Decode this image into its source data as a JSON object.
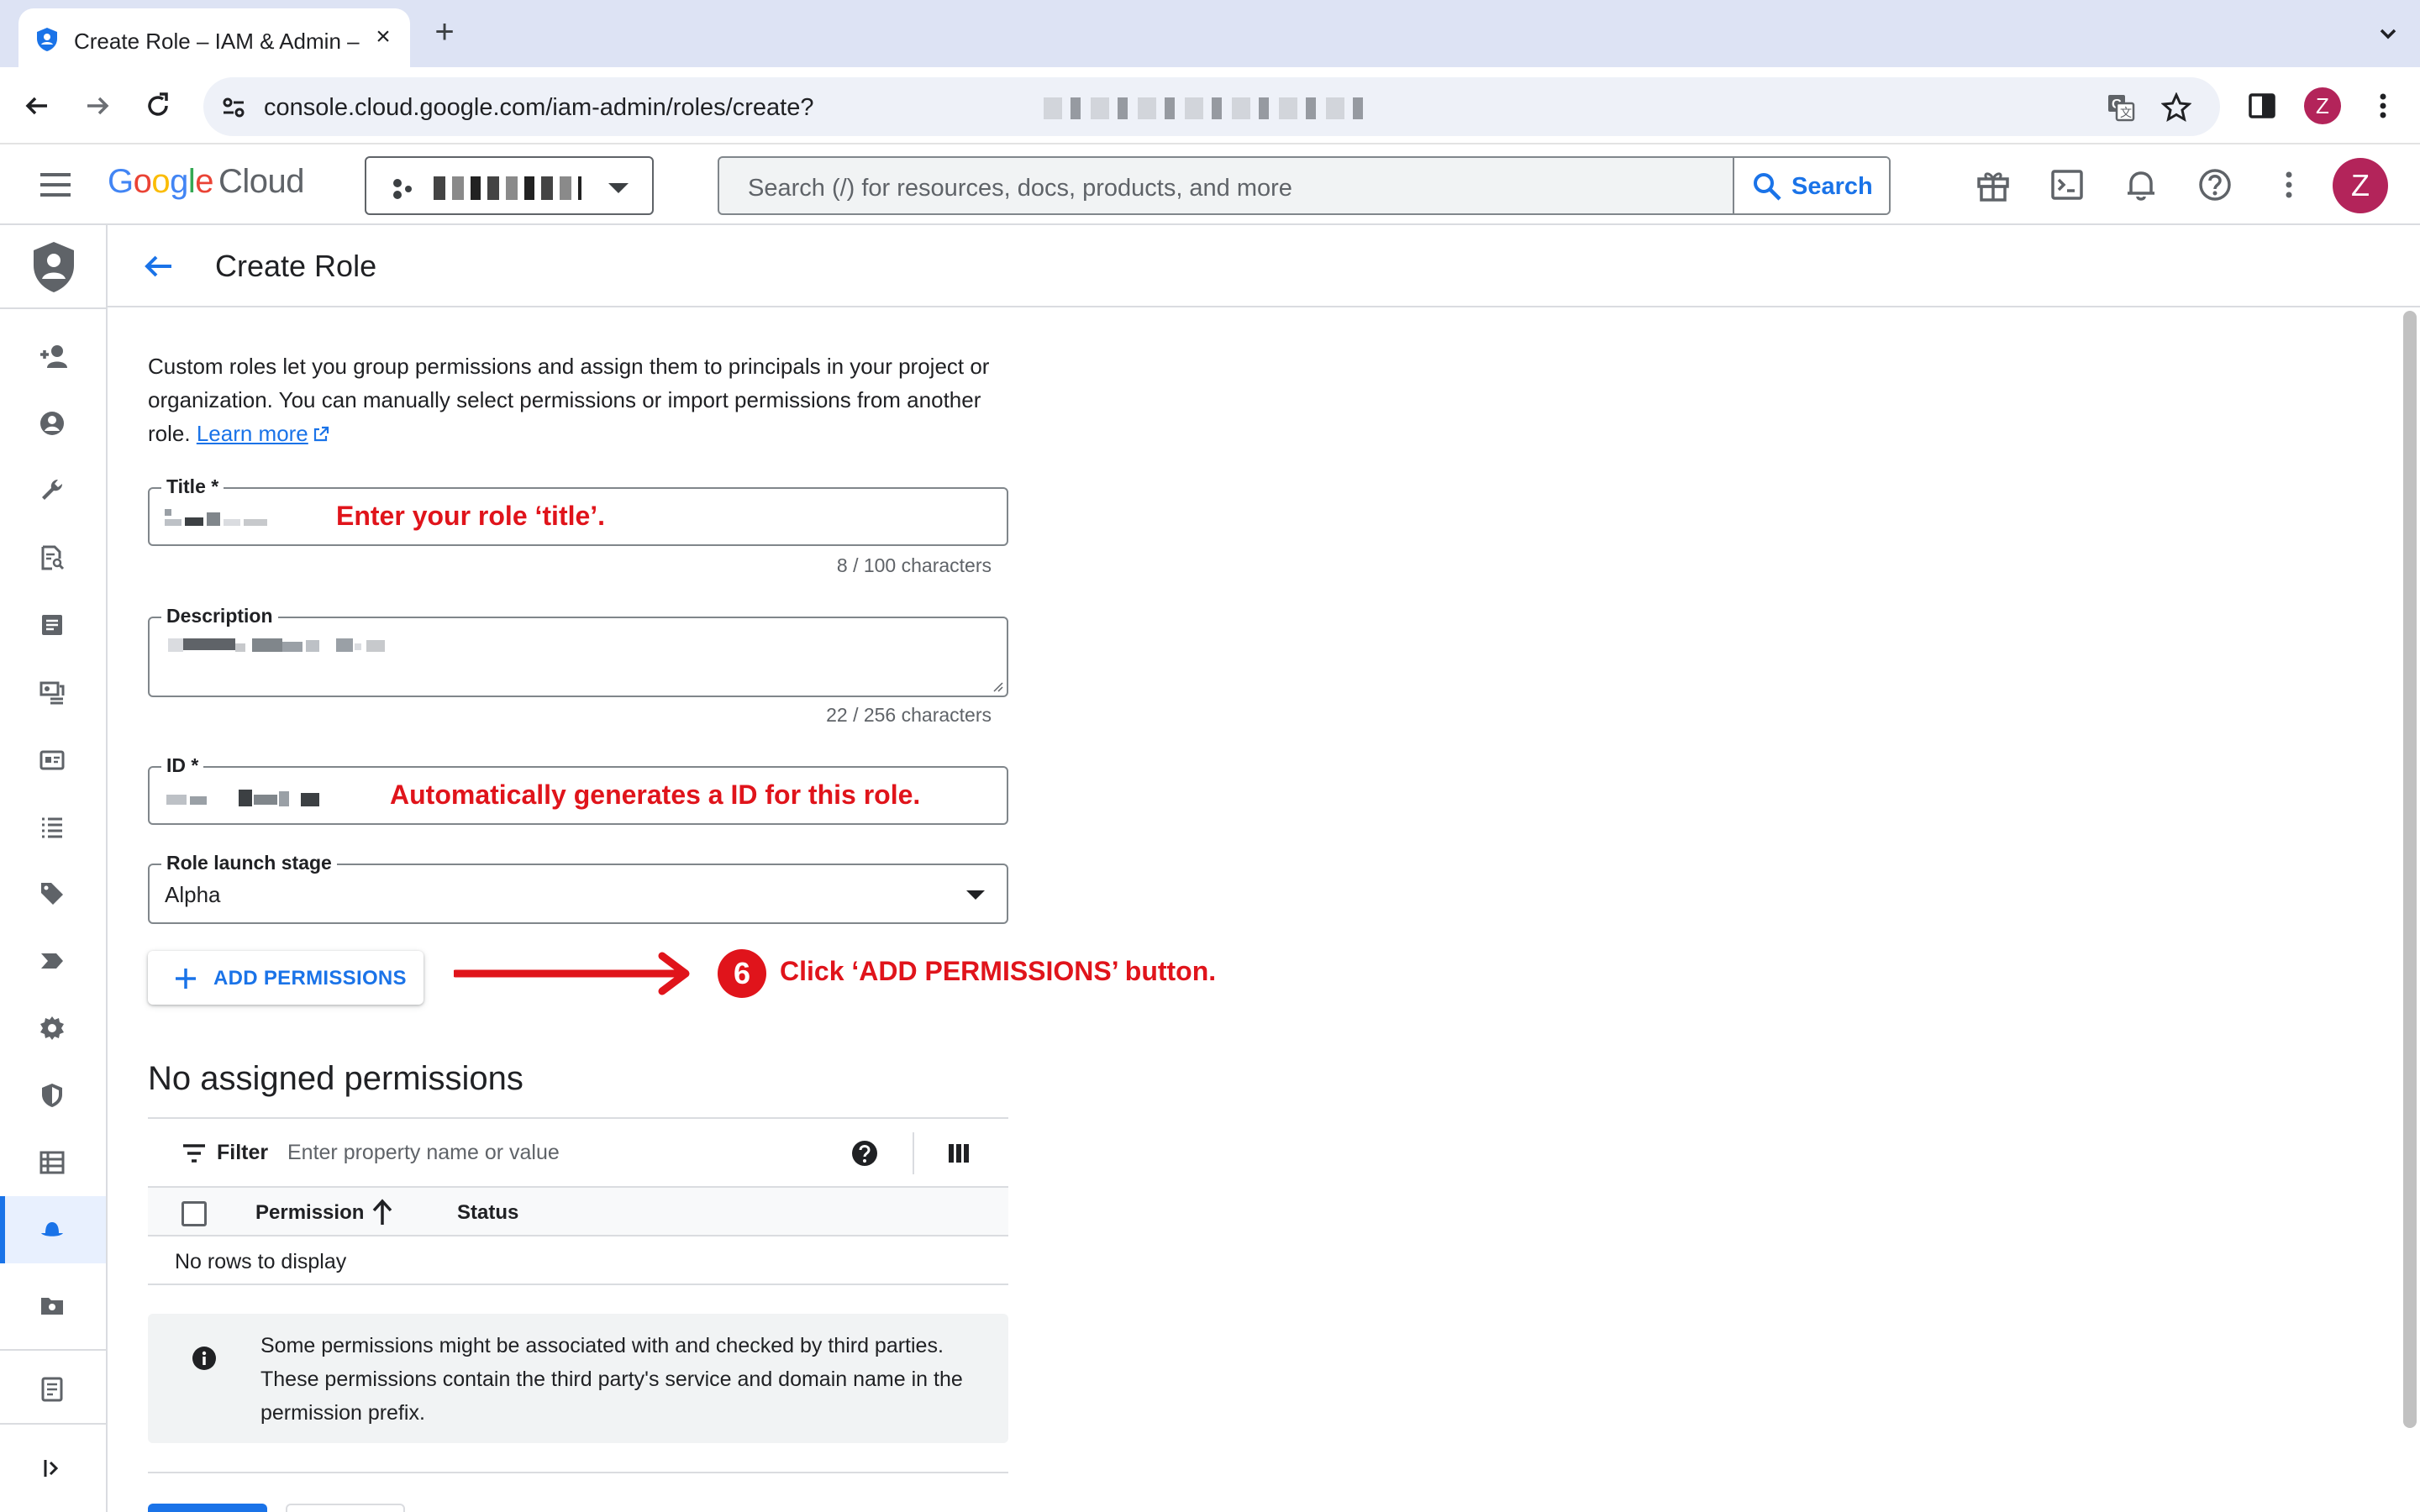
{
  "browser": {
    "tab_title": "Create Role – IAM & Admin –",
    "url": "console.cloud.google.com/iam-admin/roles/create?",
    "avatar_letter": "Z"
  },
  "header": {
    "logo_google": [
      "G",
      "o",
      "o",
      "g",
      "l",
      "e"
    ],
    "logo_cloud": "Cloud",
    "search_placeholder": "Search (/) for resources, docs, products, and more",
    "search_button": "Search",
    "avatar_letter": "Z"
  },
  "page": {
    "title": "Create Role",
    "intro_text": "Custom roles let you group permissions and assign them to principals in your project or organization. You can manually select permissions or import permissions from another role.",
    "learn_more": "Learn more"
  },
  "form": {
    "title_label": "Title *",
    "title_counter": "8 / 100 characters",
    "title_annotation": "Enter your role ‘title’.",
    "description_label": "Description",
    "description_counter": "22 / 256 characters",
    "id_label": "ID *",
    "id_annotation": "Automatically generates a ID for this role.",
    "launch_stage_label": "Role launch stage",
    "launch_stage_value": "Alpha",
    "add_permissions_button": "ADD PERMISSIONS",
    "step_number": "6",
    "step_annotation": "Click ‘ADD PERMISSIONS’ button."
  },
  "permissions": {
    "section_title": "No assigned permissions",
    "filter_label": "Filter",
    "filter_placeholder": "Enter property name or value",
    "col_permission": "Permission",
    "col_status": "Status",
    "empty_text": "No rows to display",
    "info_text": "Some permissions might be associated with and checked by third parties. These permissions contain the third party's service and domain name in the permission prefix."
  },
  "colors": {
    "accent": "#1a73e8",
    "annotation_red": "#e0141b",
    "avatar": "#b3245a"
  },
  "icons": [
    "security-shield-icon",
    "close-icon",
    "plus-icon",
    "back-icon",
    "forward-icon",
    "reload-icon",
    "translate-icon",
    "star-icon",
    "sidepanel-icon",
    "more-vert-icon",
    "hamburger-icon",
    "search-icon",
    "gift-icon",
    "terminal-icon",
    "bell-icon",
    "help-icon",
    "arrow-back-icon",
    "external-link-icon",
    "filter-icon",
    "columns-icon",
    "sort-up-icon",
    "info-icon"
  ]
}
